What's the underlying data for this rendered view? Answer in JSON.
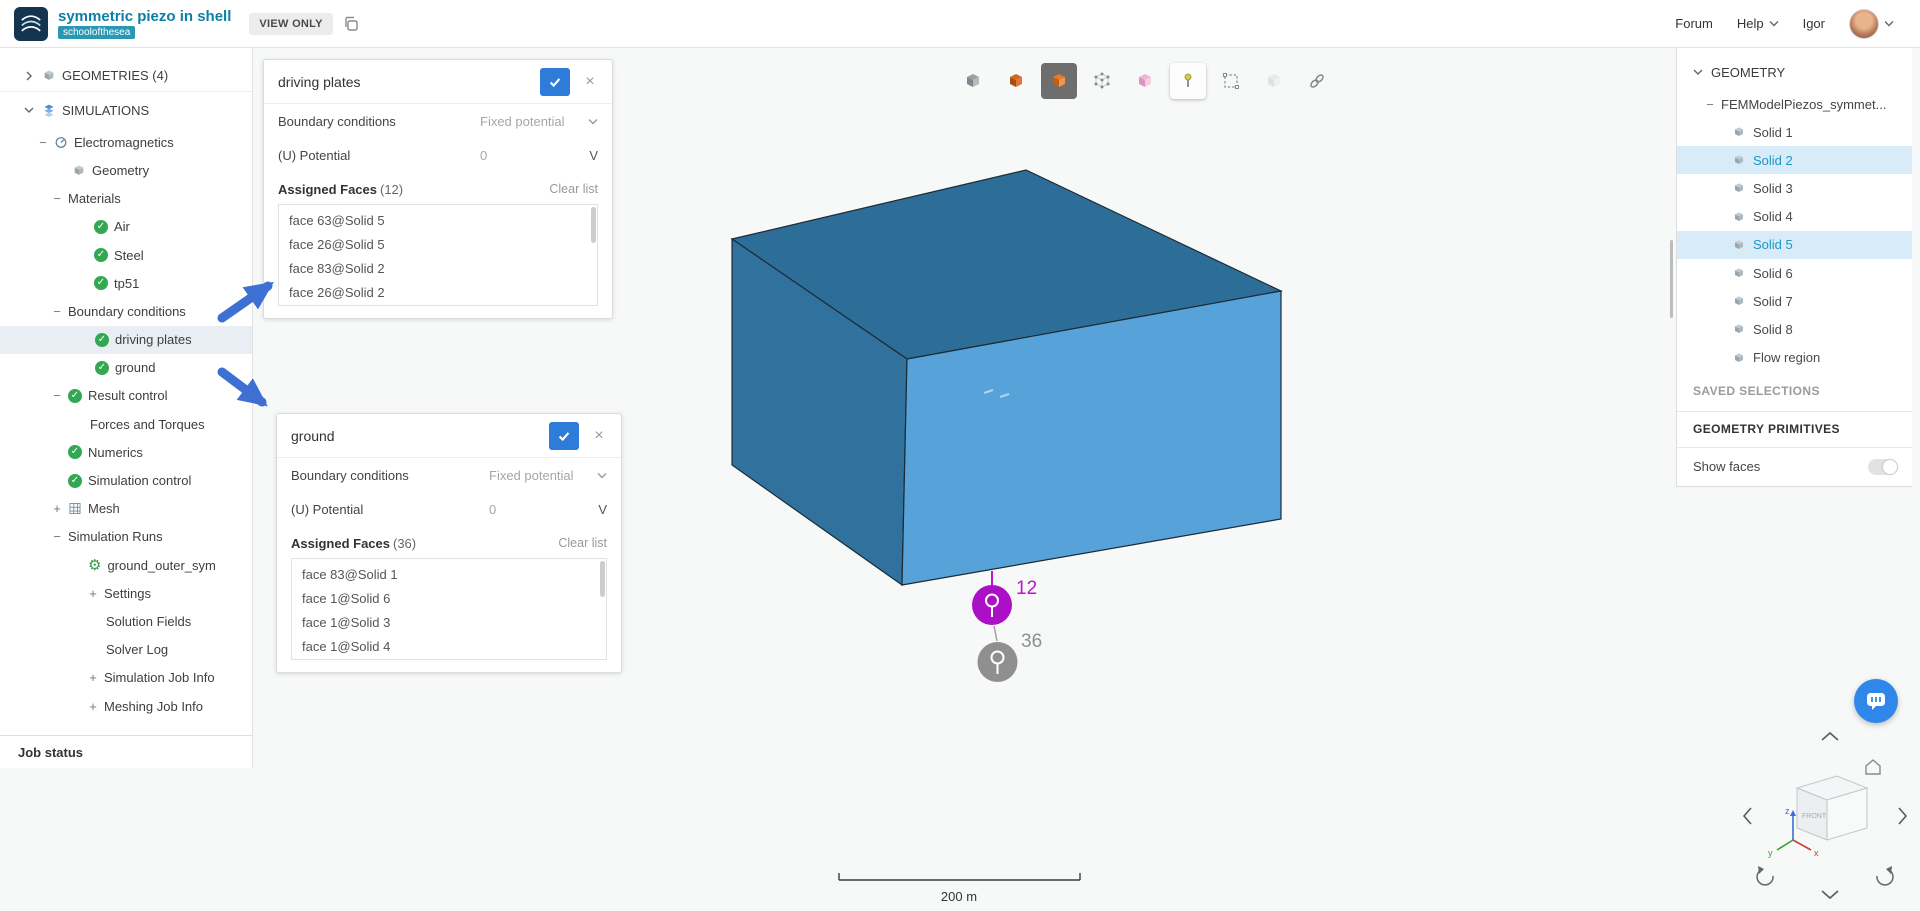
{
  "icons": {
    "check": "✓",
    "close": "×",
    "plus": "+",
    "minus": "−",
    "gear": "⚙"
  },
  "header": {
    "project_title": "symmetric piezo in shell",
    "project_owner": "schoolofthesea",
    "view_only_label": "VIEW ONLY",
    "forum_label": "Forum",
    "help_label": "Help",
    "user_name": "Igor"
  },
  "left_sidebar": {
    "job_status_label": "Job status",
    "tree": [
      {
        "label": "GEOMETRIES (4)"
      },
      {
        "label": "SIMULATIONS"
      },
      {
        "label": "Electromagnetics"
      },
      {
        "label": "Geometry"
      },
      {
        "label": "Materials"
      },
      {
        "label": "Air"
      },
      {
        "label": "Steel"
      },
      {
        "label": "tp51"
      },
      {
        "label": "Boundary conditions"
      },
      {
        "label": "driving plates"
      },
      {
        "label": "ground"
      },
      {
        "label": "Result control"
      },
      {
        "label": "Forces and Torques"
      },
      {
        "label": "Numerics"
      },
      {
        "label": "Simulation control"
      },
      {
        "label": "Mesh"
      },
      {
        "label": "Simulation Runs"
      },
      {
        "label": "ground_outer_sym"
      },
      {
        "label": "Settings"
      },
      {
        "label": "Solution Fields"
      },
      {
        "label": "Solver Log"
      },
      {
        "label": "Simulation Job Info"
      },
      {
        "label": "Meshing Job Info"
      }
    ]
  },
  "panels": {
    "driving_plates": {
      "title": "driving plates",
      "boundary_conditions_label": "Boundary conditions",
      "boundary_conditions_value": "Fixed potential",
      "potential_label": "(U) Potential",
      "potential_value": "0",
      "potential_unit": "V",
      "assigned_faces_label": "Assigned Faces",
      "assigned_faces_count": "(12)",
      "clear_list_label": "Clear list",
      "faces": [
        "face 63@Solid 5",
        "face 26@Solid 5",
        "face 83@Solid 2",
        "face 26@Solid 2"
      ]
    },
    "ground": {
      "title": "ground",
      "boundary_conditions_label": "Boundary conditions",
      "boundary_conditions_value": "Fixed potential",
      "potential_label": "(U) Potential",
      "potential_value": "0",
      "potential_unit": "V",
      "assigned_faces_label": "Assigned Faces",
      "assigned_faces_count": "(36)",
      "clear_list_label": "Clear list",
      "faces": [
        "face 83@Solid 1",
        "face 1@Solid 6",
        "face 1@Solid 3",
        "face 1@Solid 4"
      ]
    }
  },
  "toolbar": {
    "buttons": [
      {
        "name": "view-solid",
        "state": "normal"
      },
      {
        "name": "view-shaded",
        "state": "normal"
      },
      {
        "name": "view-surfaces",
        "state": "active-dark"
      },
      {
        "name": "view-vertices",
        "state": "normal"
      },
      {
        "name": "view-transparent",
        "state": "normal"
      },
      {
        "name": "probe-point",
        "state": "active-light"
      },
      {
        "name": "box-select",
        "state": "normal"
      },
      {
        "name": "view-hidden",
        "state": "disabled"
      },
      {
        "name": "link",
        "state": "normal"
      }
    ]
  },
  "viewport": {
    "pin_label_magenta": "12",
    "pin_label_gray": "36",
    "scale_label": "200 m",
    "colors": {
      "box_top": "#2d6e98",
      "box_left": "#30719d",
      "box_right": "#57a3d9",
      "pin_magenta": "#ab10c6",
      "pin_gray": "#8f8f8f",
      "arrow_blue": "#3e6fd2"
    }
  },
  "right_panel": {
    "geometry_header": "GEOMETRY",
    "model_name": "FEMModelPiezos_symmet...",
    "solids": [
      {
        "label": "Solid 1"
      },
      {
        "label": "Solid 2"
      },
      {
        "label": "Solid 3"
      },
      {
        "label": "Solid 4"
      },
      {
        "label": "Solid 5"
      },
      {
        "label": "Solid 6"
      },
      {
        "label": "Solid 7"
      },
      {
        "label": "Solid 8"
      },
      {
        "label": "Flow region"
      }
    ],
    "saved_selections_label": "SAVED SELECTIONS",
    "geometry_primitives_label": "GEOMETRY PRIMITIVES",
    "show_faces_label": "Show faces"
  },
  "nav_cube": {
    "front_label": "FRONT",
    "axes": [
      "x",
      "y",
      "z"
    ]
  }
}
